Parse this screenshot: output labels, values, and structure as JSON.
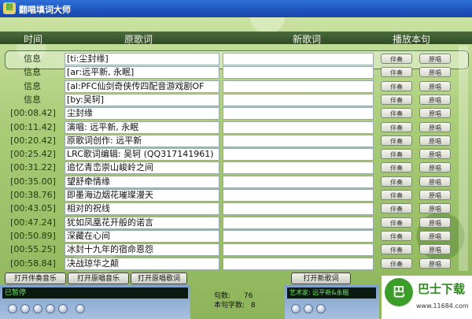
{
  "window": {
    "title": "翻唱填词大师",
    "icon_text": "翻"
  },
  "columns": {
    "time": "时间",
    "original": "原歌词",
    "new": "新歌词",
    "play": "播放本句"
  },
  "rows": [
    {
      "time": "信息",
      "lyric": "[ti:尘封缘]"
    },
    {
      "time": "信息",
      "lyric": "[ar:远平新, 永眠]"
    },
    {
      "time": "信息",
      "lyric": "[al:PFC仙剑奇侠传四配音游戏剧OF"
    },
    {
      "time": "信息",
      "lyric": "[by:吴轲]"
    },
    {
      "time": "[00:08.42]",
      "lyric": "尘封缘"
    },
    {
      "time": "[00:11.42]",
      "lyric": "演唱: 远平新, 永眠"
    },
    {
      "time": "[00:20.42]",
      "lyric": "原歌词创作: 远平新"
    },
    {
      "time": "[00:25.42]",
      "lyric": "LRC歌词编辑: 吴轲 (QQ317141961)"
    },
    {
      "time": "[00:31.22]",
      "lyric": "追忆青峦崇山峻岭之间"
    },
    {
      "time": "[00:35.00]",
      "lyric": "望舒牵情缘"
    },
    {
      "time": "[00:38.76]",
      "lyric": "即墨海边烟花璀璨漫天"
    },
    {
      "time": "[00:43.05]",
      "lyric": "相对的祝线"
    },
    {
      "time": "[00:47.24]",
      "lyric": "犹如凤凰花开般的诺言"
    },
    {
      "time": "[00:50.89]",
      "lyric": "深藏在心间"
    },
    {
      "time": "[00:55.25]",
      "lyric": "冰封十九年的宿命恩怨"
    },
    {
      "time": "[00:58.84]",
      "lyric": "决战琼华之颠"
    }
  ],
  "row_buttons": {
    "accompany": "伴奏",
    "original": "原唱"
  },
  "bottom_buttons": {
    "open_accompany": "打开伴奏音乐",
    "open_original": "打开原唱音乐",
    "open_original_lyrics": "打开原唱歌词",
    "open_new_lyrics": "打开新歌词"
  },
  "player_left": {
    "status": "已暂停"
  },
  "player_right": {
    "status": "艺术家: 远平新&永眠"
  },
  "stats": {
    "sentences_label": "句数:",
    "sentences": "76",
    "chars_label": "本句字数:",
    "chars": "8"
  },
  "watermark": {
    "logo": "巴",
    "text": "巴士下载",
    "url": "www.11684.com"
  }
}
